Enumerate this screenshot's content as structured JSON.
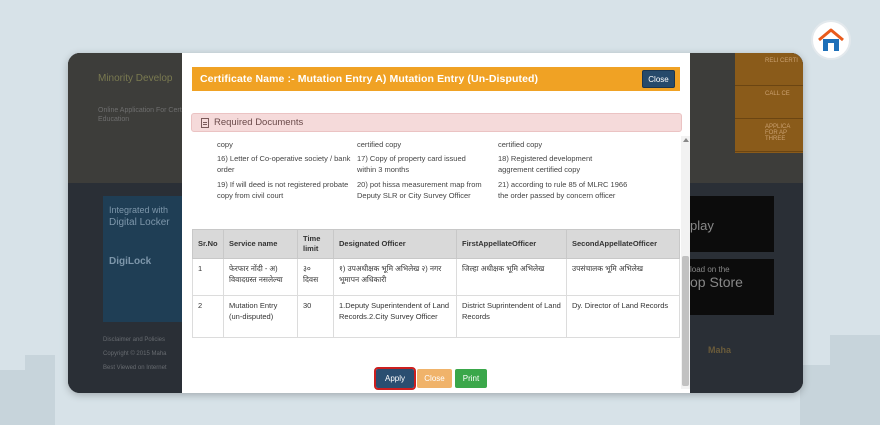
{
  "background_page": {
    "minority_heading": "Minority Develop",
    "online_text": "Online Application For Certificate to Education",
    "right_links": [
      "RELI CERTI",
      "CALL CE",
      "APPLICA FOR AP THREE"
    ],
    "digilocker": {
      "line1": "Integrated with",
      "line2": "Digital Locker",
      "brand": "DigiLock"
    },
    "google_play": "play",
    "app_store": {
      "line1": "load on the",
      "line2": "op Store"
    },
    "footer": [
      "Disclaimer and Policies",
      "Copyright © 2015 Maha",
      "Best Viewed on Internet"
    ],
    "maha_logo": "Maha"
  },
  "modal": {
    "title": "Certificate Name :- Mutation Entry A) Mutation Entry (Un-Disputed)",
    "close_top_label": "Close",
    "required_docs_heading": "Required Documents",
    "documents": [
      "copy",
      "certified copy",
      "certified copy",
      "16) Letter of Co-operative society / bank order",
      "17) Copy of property card issued within 3 months",
      "18) Registered development aggrement certified copy",
      "19) If will deed is not registered probate copy from civil court",
      "20) pot hissa measurement map from Deputy SLR or City Survey Officer",
      "21) according to rule 85 of MLRC 1966 the order passed by concern officer"
    ],
    "table": {
      "headers": [
        "Sr.No",
        "Service name",
        "Time limit",
        "Designated Officer",
        "FirstAppellateOfficer",
        "SecondAppellateOfficer"
      ],
      "rows": [
        [
          "1",
          "फेरफार नोंदी - अ) विवादग्रस्त नसलेल्या",
          "३० दिवस",
          "१) उपअधीक्षक भूमि अभिलेख २) नगर भूमापन अधिकारी",
          "जिल्हा अधीक्षक भूमि अभिलेख",
          "उपसंचालक भूमि अभिलेख"
        ],
        [
          "2",
          "Mutation Entry (un-disputed)",
          "30",
          "1.Deputy Superintendent of Land Records.2.City Survey Officer",
          "District Suprintendent of Land Records",
          "Dy. Director of Land Records"
        ]
      ]
    },
    "buttons": {
      "apply": "Apply",
      "close": "Close",
      "print": "Print"
    }
  },
  "colors": {
    "title_bar": "#f0a224",
    "close_top": "#264a6b",
    "apply": "#2a4e70",
    "close": "#f0b36a",
    "print": "#3aa74a",
    "highlight": "#cc1f1f"
  }
}
